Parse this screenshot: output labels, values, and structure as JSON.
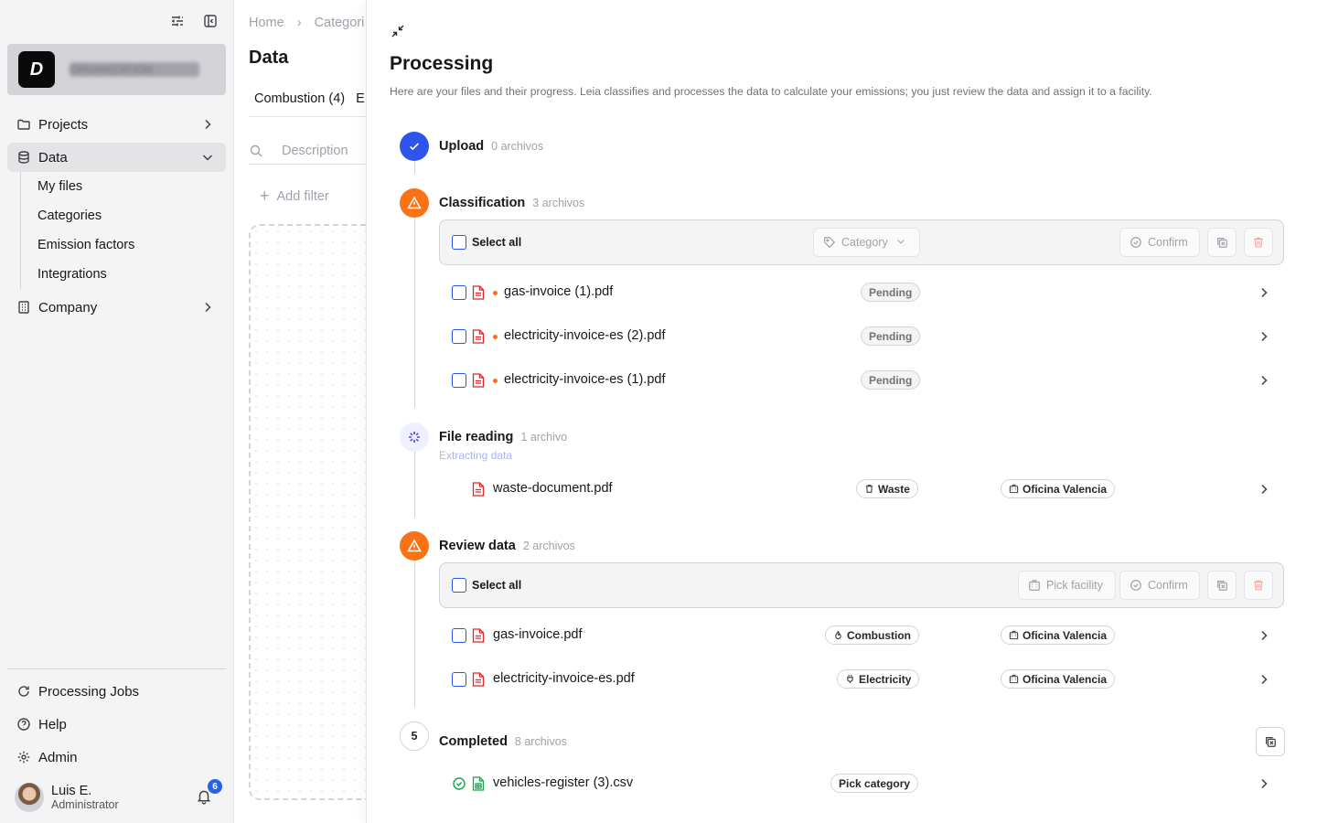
{
  "sidebar": {
    "org_name": "ORGANIZATION",
    "nav": {
      "projects": "Projects",
      "data": "Data",
      "company": "Company"
    },
    "data_sub": [
      "My files",
      "Categories",
      "Emission factors",
      "Integrations"
    ],
    "bottom": {
      "processing_jobs": "Processing Jobs",
      "help": "Help",
      "admin": "Admin"
    },
    "user": {
      "name": "Luis E.",
      "role": "Administrator"
    },
    "notifications": "6"
  },
  "background_page": {
    "breadcrumb": [
      "Home",
      "Categori"
    ],
    "title": "Data",
    "tabs": [
      "Combustion (4)",
      "E"
    ],
    "search_placeholder": "Description",
    "add_filter": "Add filter"
  },
  "panel": {
    "title": "Processing",
    "description": "Here are your files and their progress. Leia classifies and processes the data to calculate your emissions; you just review the data and assign it to a facility.",
    "steps": {
      "upload": {
        "name": "Upload",
        "count": "0 archivos"
      },
      "classification": {
        "name": "Classification",
        "count": "3 archivos",
        "select_all": "Select all",
        "category_button": "Category",
        "confirm_button": "Confirm",
        "files": [
          {
            "name": "gas-invoice (1).pdf",
            "status": "Pending"
          },
          {
            "name": "electricity-invoice-es (2).pdf",
            "status": "Pending"
          },
          {
            "name": "electricity-invoice-es (1).pdf",
            "status": "Pending"
          }
        ]
      },
      "file_reading": {
        "name": "File reading",
        "count": "1 archivo",
        "sub": "Extracting data",
        "files": [
          {
            "name": "waste-document.pdf",
            "category": "Waste",
            "facility": "Oficina Valencia"
          }
        ]
      },
      "review": {
        "name": "Review data",
        "count": "2 archivos",
        "select_all": "Select all",
        "pick_facility": "Pick facility",
        "confirm_button": "Confirm",
        "files": [
          {
            "name": "gas-invoice.pdf",
            "category": "Combustion",
            "facility": "Oficina Valencia"
          },
          {
            "name": "electricity-invoice-es.pdf",
            "category": "Electricity",
            "facility": "Oficina Valencia"
          }
        ]
      },
      "completed": {
        "number": "5",
        "name": "Completed",
        "count": "8 archivos",
        "files": [
          {
            "name": "vehicles-register (3).csv",
            "category": "Pick category"
          }
        ]
      }
    }
  }
}
